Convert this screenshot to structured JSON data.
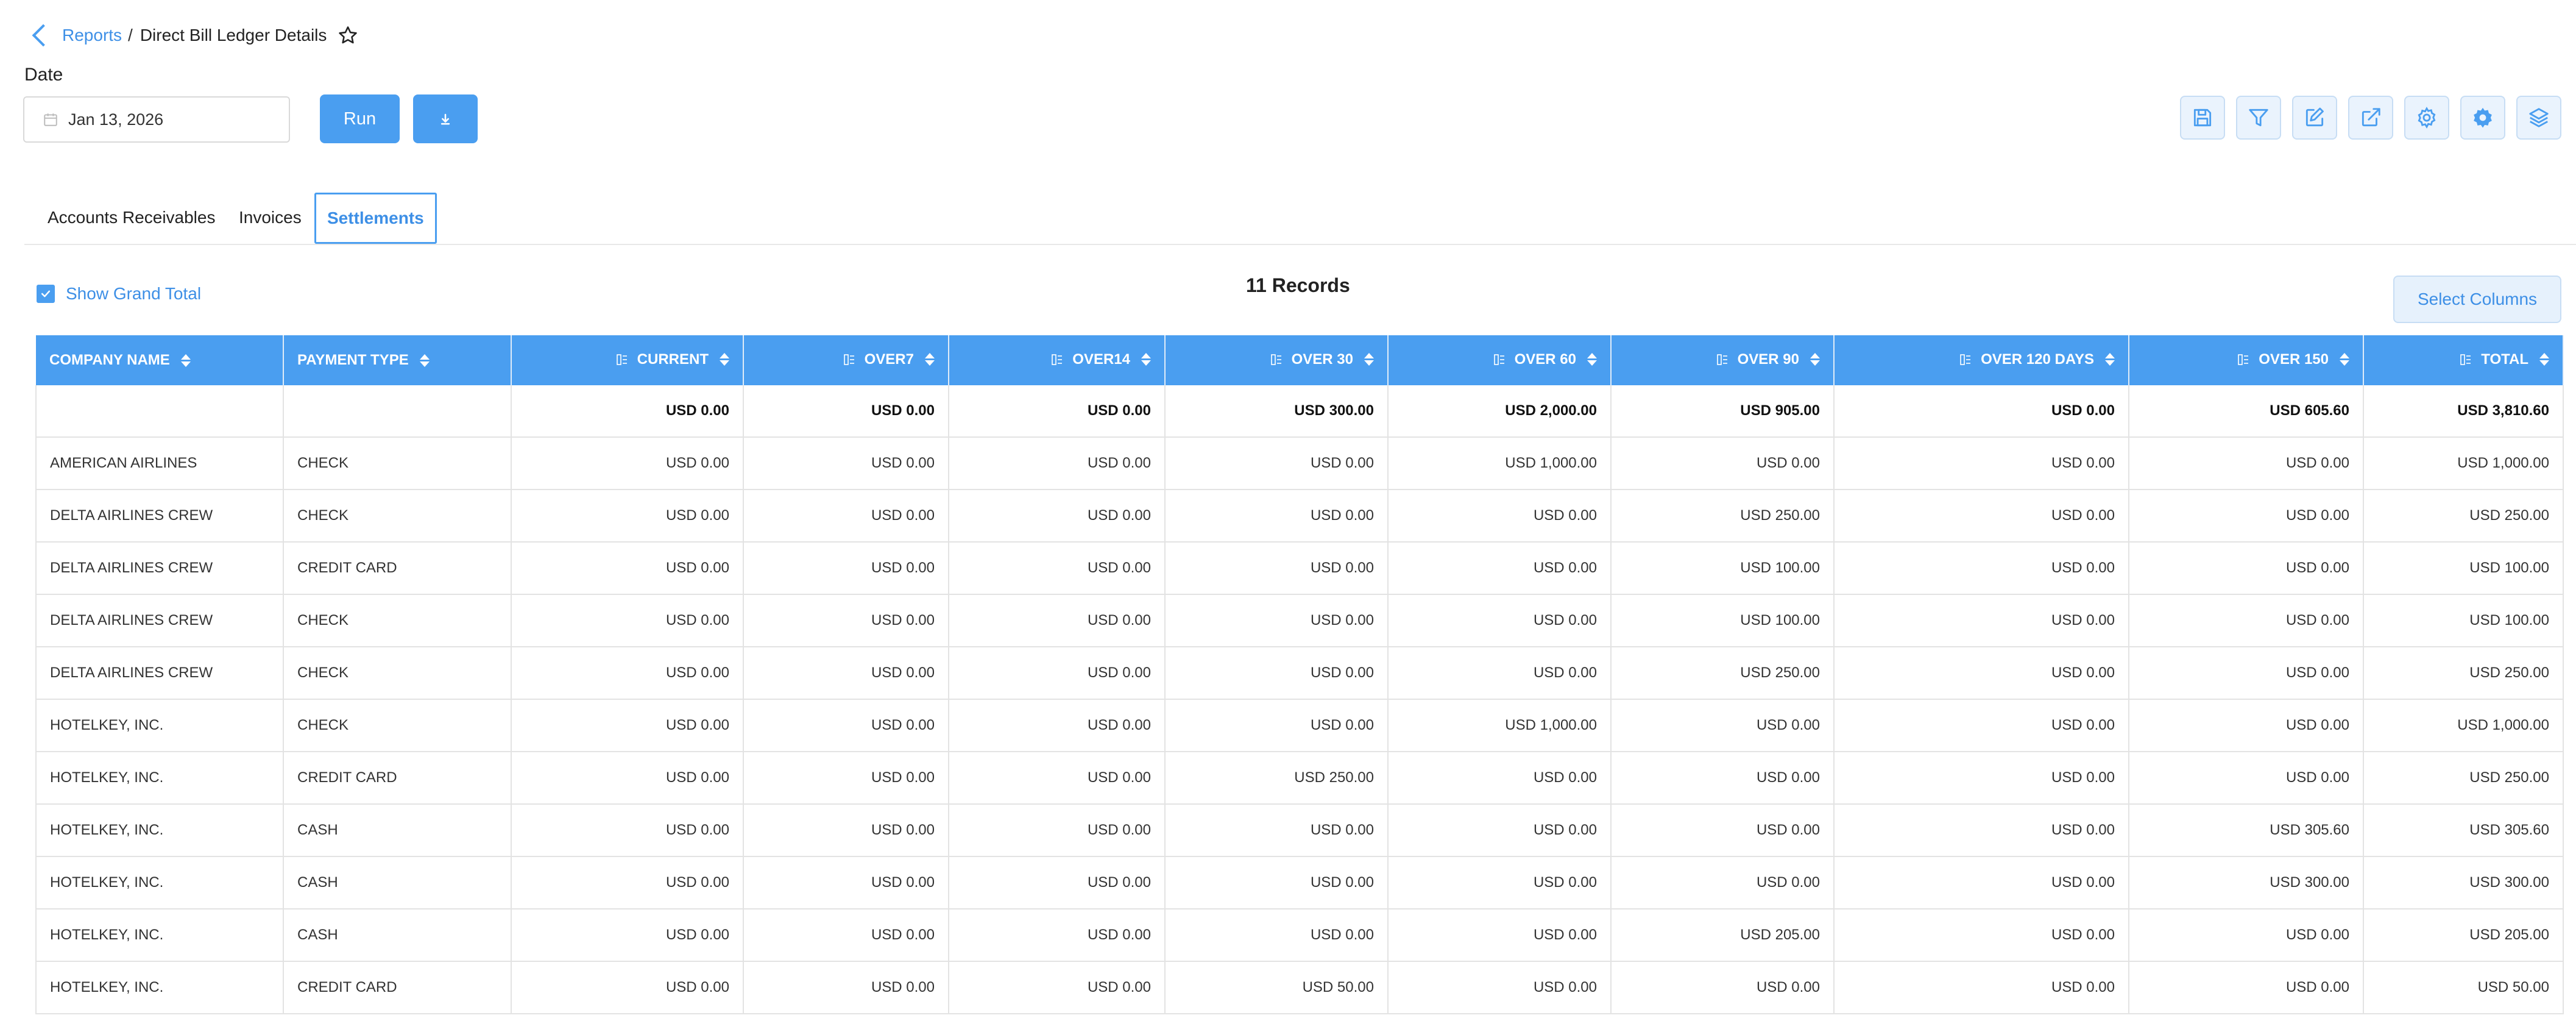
{
  "breadcrumb": {
    "parent": "Reports",
    "separator": "/",
    "title": "Direct Bill Ledger Details"
  },
  "date": {
    "label": "Date",
    "value": "Jan 13, 2026"
  },
  "actions": {
    "run_label": "Run"
  },
  "toolbar": [
    "save-icon",
    "filter-icon",
    "edit-icon",
    "external-link-icon",
    "gear-icon",
    "settings-cog-icon",
    "layers-icon"
  ],
  "tabs": [
    {
      "label": "Accounts Receivables",
      "active": false
    },
    {
      "label": "Invoices",
      "active": false
    },
    {
      "label": "Settlements",
      "active": true
    }
  ],
  "grand_total": {
    "label": "Show Grand Total",
    "checked": true
  },
  "records_label": "11 Records",
  "select_columns_label": "Select Columns",
  "table": {
    "columns": [
      "COMPANY NAME",
      "PAYMENT TYPE",
      "CURRENT",
      "OVER7",
      "OVER14",
      "OVER 30",
      "OVER 60",
      "OVER 90",
      "OVER 120 DAYS",
      "OVER 150",
      "TOTAL"
    ],
    "totals": [
      "",
      "",
      "USD 0.00",
      "USD 0.00",
      "USD 0.00",
      "USD 300.00",
      "USD 2,000.00",
      "USD 905.00",
      "USD 0.00",
      "USD 605.60",
      "USD 3,810.60"
    ],
    "rows": [
      [
        "AMERICAN AIRLINES",
        "CHECK",
        "USD 0.00",
        "USD 0.00",
        "USD 0.00",
        "USD 0.00",
        "USD 1,000.00",
        "USD 0.00",
        "USD 0.00",
        "USD 0.00",
        "USD 1,000.00"
      ],
      [
        "DELTA AIRLINES CREW",
        "CHECK",
        "USD 0.00",
        "USD 0.00",
        "USD 0.00",
        "USD 0.00",
        "USD 0.00",
        "USD 250.00",
        "USD 0.00",
        "USD 0.00",
        "USD 250.00"
      ],
      [
        "DELTA AIRLINES CREW",
        "CREDIT CARD",
        "USD 0.00",
        "USD 0.00",
        "USD 0.00",
        "USD 0.00",
        "USD 0.00",
        "USD 100.00",
        "USD 0.00",
        "USD 0.00",
        "USD 100.00"
      ],
      [
        "DELTA AIRLINES CREW",
        "CHECK",
        "USD 0.00",
        "USD 0.00",
        "USD 0.00",
        "USD 0.00",
        "USD 0.00",
        "USD 100.00",
        "USD 0.00",
        "USD 0.00",
        "USD 100.00"
      ],
      [
        "DELTA AIRLINES CREW",
        "CHECK",
        "USD 0.00",
        "USD 0.00",
        "USD 0.00",
        "USD 0.00",
        "USD 0.00",
        "USD 250.00",
        "USD 0.00",
        "USD 0.00",
        "USD 250.00"
      ],
      [
        "HOTELKEY, INC.",
        "CHECK",
        "USD 0.00",
        "USD 0.00",
        "USD 0.00",
        "USD 0.00",
        "USD 1,000.00",
        "USD 0.00",
        "USD 0.00",
        "USD 0.00",
        "USD 1,000.00"
      ],
      [
        "HOTELKEY, INC.",
        "CREDIT CARD",
        "USD 0.00",
        "USD 0.00",
        "USD 0.00",
        "USD 250.00",
        "USD 0.00",
        "USD 0.00",
        "USD 0.00",
        "USD 0.00",
        "USD 250.00"
      ],
      [
        "HOTELKEY, INC.",
        "CASH",
        "USD 0.00",
        "USD 0.00",
        "USD 0.00",
        "USD 0.00",
        "USD 0.00",
        "USD 0.00",
        "USD 0.00",
        "USD 305.60",
        "USD 305.60"
      ],
      [
        "HOTELKEY, INC.",
        "CASH",
        "USD 0.00",
        "USD 0.00",
        "USD 0.00",
        "USD 0.00",
        "USD 0.00",
        "USD 0.00",
        "USD 0.00",
        "USD 300.00",
        "USD 300.00"
      ],
      [
        "HOTELKEY, INC.",
        "CASH",
        "USD 0.00",
        "USD 0.00",
        "USD 0.00",
        "USD 0.00",
        "USD 0.00",
        "USD 205.00",
        "USD 0.00",
        "USD 0.00",
        "USD 205.00"
      ],
      [
        "HOTELKEY, INC.",
        "CREDIT CARD",
        "USD 0.00",
        "USD 0.00",
        "USD 0.00",
        "USD 50.00",
        "USD 0.00",
        "USD 0.00",
        "USD 0.00",
        "USD 0.00",
        "USD 50.00"
      ]
    ]
  }
}
